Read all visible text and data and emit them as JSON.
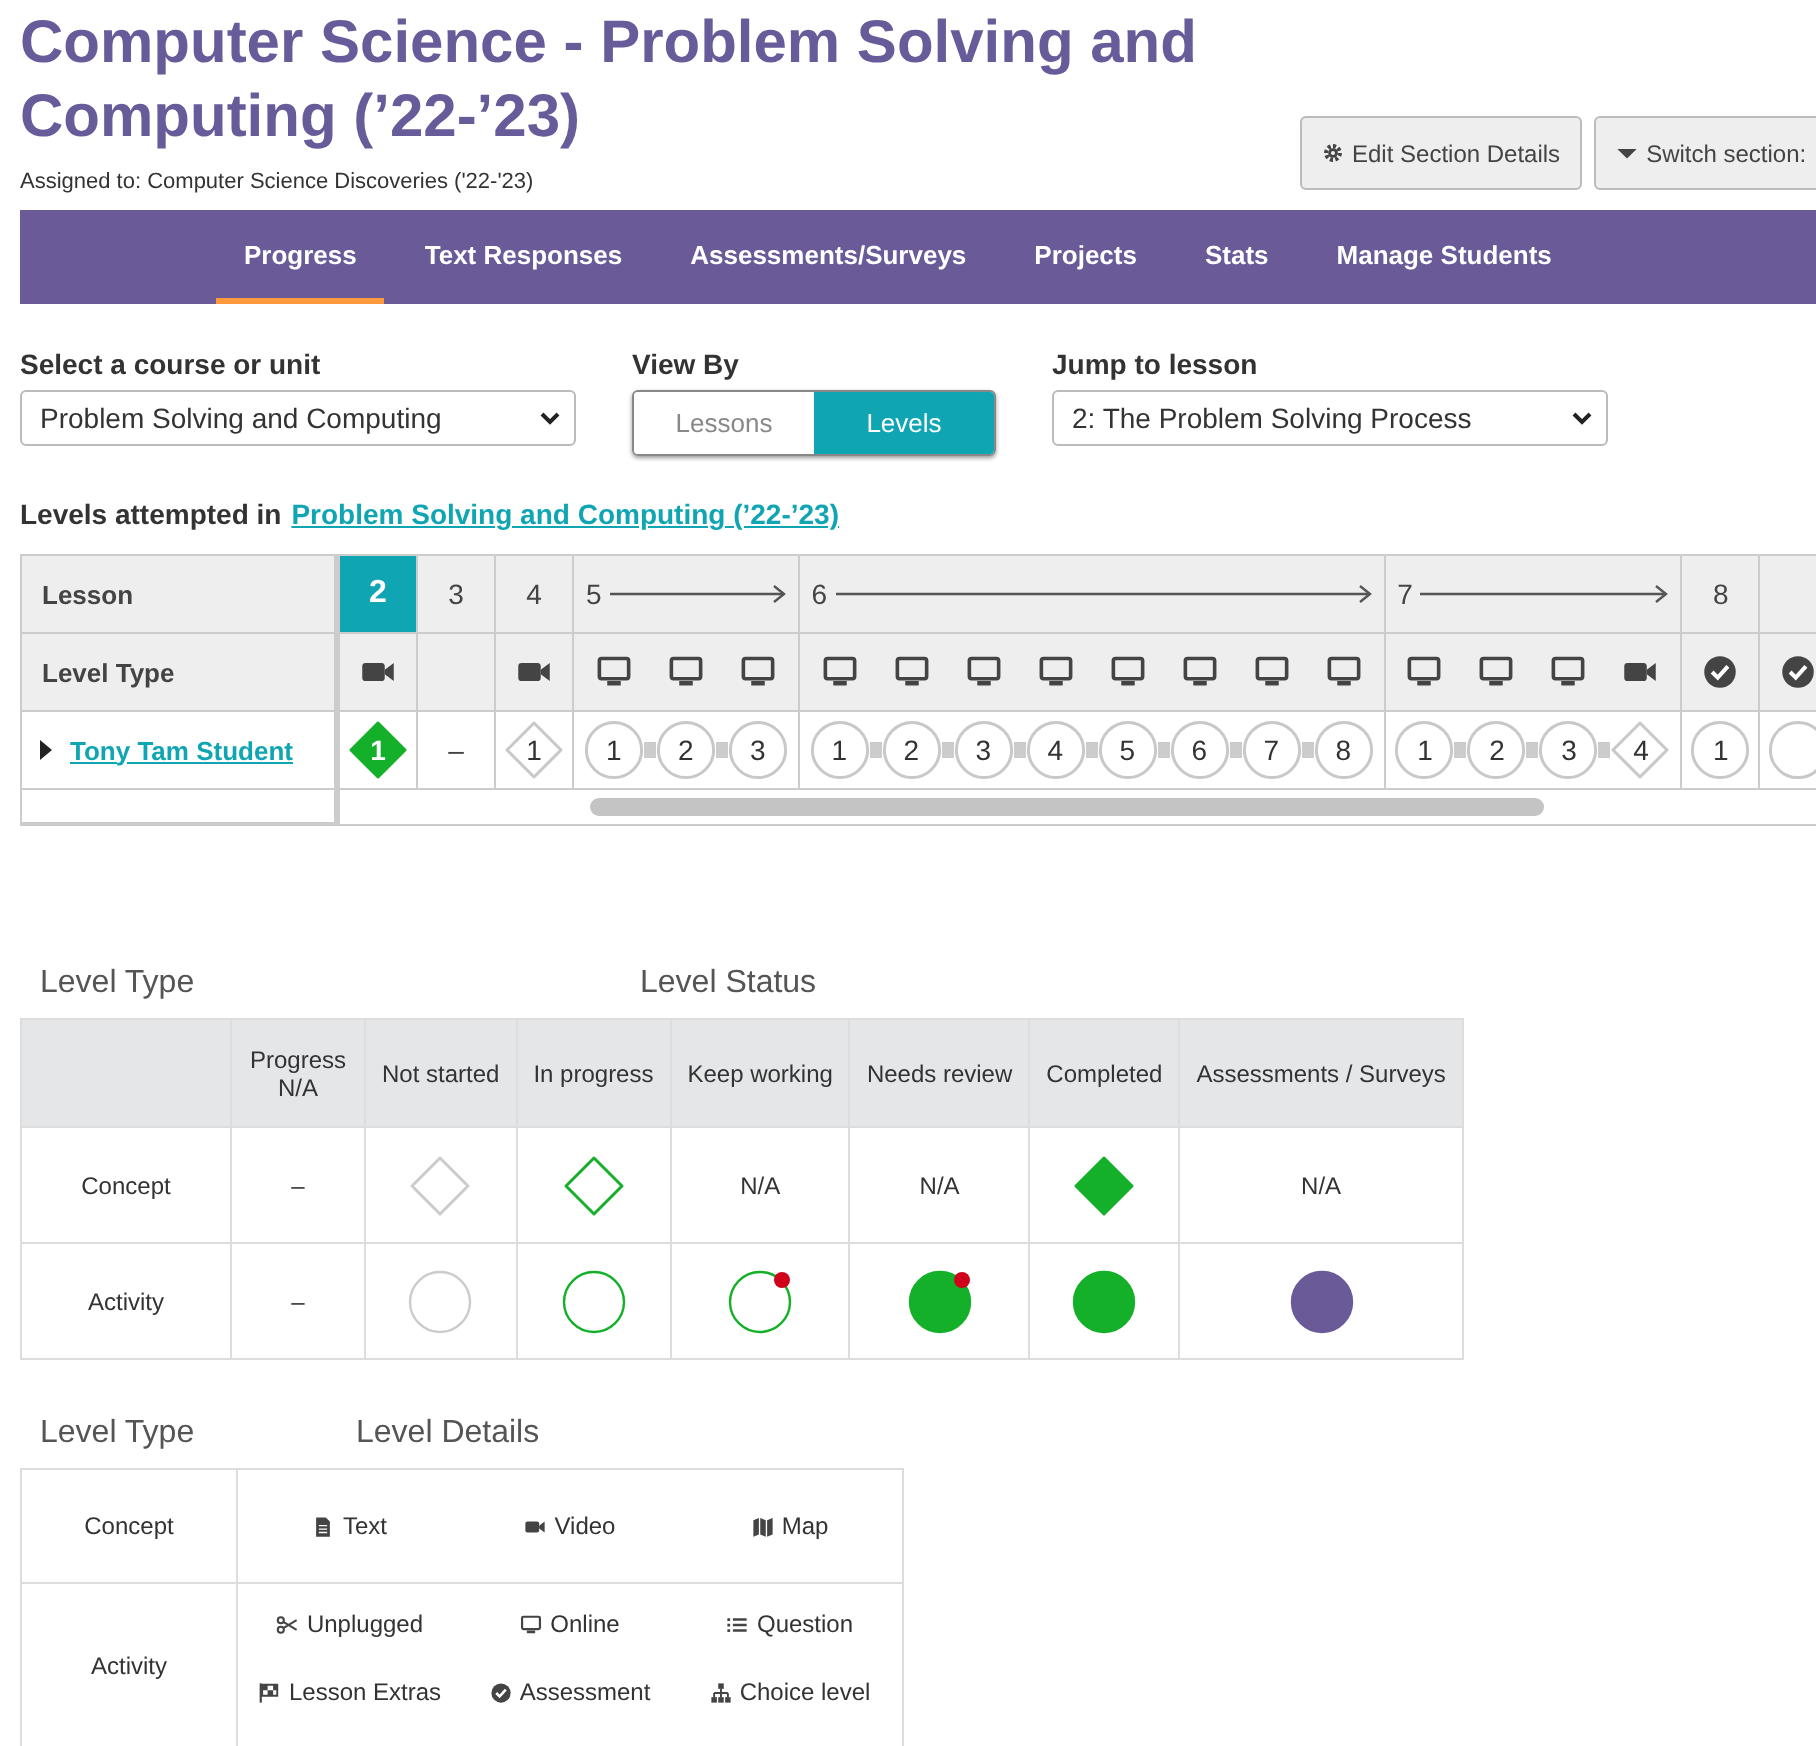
{
  "header": {
    "title": "Computer Science - Problem Solving and Computing (’22-’23)",
    "assigned": "Assigned to: Computer Science Discoveries ('22-'23)",
    "buttons": [
      {
        "kind": "gear",
        "label": "Edit Section Details"
      },
      {
        "kind": "caret",
        "label": "Switch section:"
      }
    ]
  },
  "tabs": [
    {
      "label": "Progress",
      "selected": true
    },
    {
      "label": "Text Responses",
      "selected": false
    },
    {
      "label": "Assessments/Surveys",
      "selected": false
    },
    {
      "label": "Projects",
      "selected": false
    },
    {
      "label": "Stats",
      "selected": false
    },
    {
      "label": "Manage Students",
      "selected": false
    }
  ],
  "filters": {
    "course": {
      "label": "Select a course or unit",
      "value": "Problem Solving and Computing"
    },
    "view_by": {
      "label": "View By",
      "options": [
        {
          "label": "Lessons",
          "selected": false
        },
        {
          "label": "Levels",
          "selected": true
        }
      ]
    },
    "jump": {
      "label": "Jump to lesson",
      "value": "2: The Problem Solving Process"
    }
  },
  "levels_attempted": {
    "text": "Levels attempted in",
    "link": "Problem Solving and Computing (’22-’23)"
  },
  "progress": {
    "row_headers": [
      "Lesson",
      "Level Type"
    ],
    "students": [
      {
        "name": "Tony Tam Student",
        "expanded": false
      }
    ],
    "lessons": [
      {
        "number": "2",
        "selected": true,
        "levels": [
          {
            "kind": "video",
            "label": "1",
            "completed": true
          }
        ]
      },
      {
        "number": "3",
        "selected": false,
        "empty_mark": "–"
      },
      {
        "number": "4",
        "selected": false,
        "levels": [
          {
            "kind": "video",
            "label": "1",
            "completed": false
          }
        ]
      },
      {
        "number": "5",
        "selected": false,
        "levels": [
          {
            "kind": "online",
            "label": "1",
            "completed": false
          },
          {
            "kind": "online",
            "label": "2",
            "completed": false
          },
          {
            "kind": "online",
            "label": "3",
            "completed": false
          }
        ]
      },
      {
        "number": "6",
        "selected": false,
        "levels": [
          {
            "kind": "online",
            "label": "1",
            "completed": false
          },
          {
            "kind": "online",
            "label": "2",
            "completed": false
          },
          {
            "kind": "online",
            "label": "3",
            "completed": false
          },
          {
            "kind": "online",
            "label": "4",
            "completed": false
          },
          {
            "kind": "online",
            "label": "5",
            "completed": false
          },
          {
            "kind": "online",
            "label": "6",
            "completed": false
          },
          {
            "kind": "online",
            "label": "7",
            "completed": false
          },
          {
            "kind": "online",
            "label": "8",
            "completed": false
          }
        ]
      },
      {
        "number": "7",
        "selected": false,
        "levels": [
          {
            "kind": "online",
            "label": "1",
            "completed": false
          },
          {
            "kind": "online",
            "label": "2",
            "completed": false
          },
          {
            "kind": "online",
            "label": "3",
            "completed": false
          },
          {
            "kind": "video",
            "label": "4",
            "completed": false
          }
        ]
      },
      {
        "number": "8",
        "selected": false,
        "levels": [
          {
            "kind": "assessment",
            "label": "1",
            "completed": false
          }
        ]
      },
      {
        "selected": false,
        "levels": [
          {
            "kind": "assessment",
            "completed": false
          }
        ]
      }
    ]
  },
  "legend": {
    "titles": [
      "Level Type",
      "Level Status"
    ],
    "columns": [
      "Progress N/A",
      "Not started",
      "In progress",
      "Keep working",
      "Needs review",
      "Completed",
      "Assessments / Surveys"
    ],
    "rows": [
      {
        "label": "Concept",
        "cells": [
          {
            "kind": "text",
            "text": "–"
          },
          {
            "kind": "diamond",
            "color": "#cccccc",
            "filled": false,
            "flagged": false
          },
          {
            "kind": "diamond",
            "color": "#14b02a",
            "filled": false,
            "flagged": false
          },
          {
            "kind": "text",
            "text": "N/A"
          },
          {
            "kind": "text",
            "text": "N/A"
          },
          {
            "kind": "diamond",
            "color": "#14b02a",
            "filled": true,
            "flagged": false
          },
          {
            "kind": "text",
            "text": "N/A"
          }
        ]
      },
      {
        "label": "Activity",
        "cells": [
          {
            "kind": "text",
            "text": "–"
          },
          {
            "kind": "circle",
            "color": "#cccccc",
            "filled": false,
            "flagged": false
          },
          {
            "kind": "circle",
            "color": "#14b02a",
            "filled": false,
            "flagged": false
          },
          {
            "kind": "circle",
            "color": "#14b02a",
            "filled": false,
            "flagged": true
          },
          {
            "kind": "circle",
            "color": "#14b02a",
            "filled": true,
            "flagged": true
          },
          {
            "kind": "circle",
            "color": "#14b02a",
            "filled": true,
            "flagged": false
          },
          {
            "kind": "circle",
            "color": "#6a5a98",
            "filled": true,
            "flagged": false
          }
        ]
      }
    ]
  },
  "details": {
    "titles": [
      "Level Type",
      "Level Details"
    ],
    "rows": [
      {
        "label": "Concept",
        "items": [
          {
            "kind": "text",
            "label": "Text"
          },
          {
            "kind": "video",
            "label": "Video"
          },
          {
            "kind": "map",
            "label": "Map"
          }
        ]
      },
      {
        "label": "Activity",
        "items": [
          {
            "kind": "unplugged",
            "label": "Unplugged"
          },
          {
            "kind": "online",
            "label": "Online"
          },
          {
            "kind": "question",
            "label": "Question"
          },
          {
            "kind": "extras",
            "label": "Lesson Extras"
          },
          {
            "kind": "assessment",
            "label": "Assessment"
          },
          {
            "kind": "choice",
            "label": "Choice level"
          }
        ]
      }
    ]
  }
}
